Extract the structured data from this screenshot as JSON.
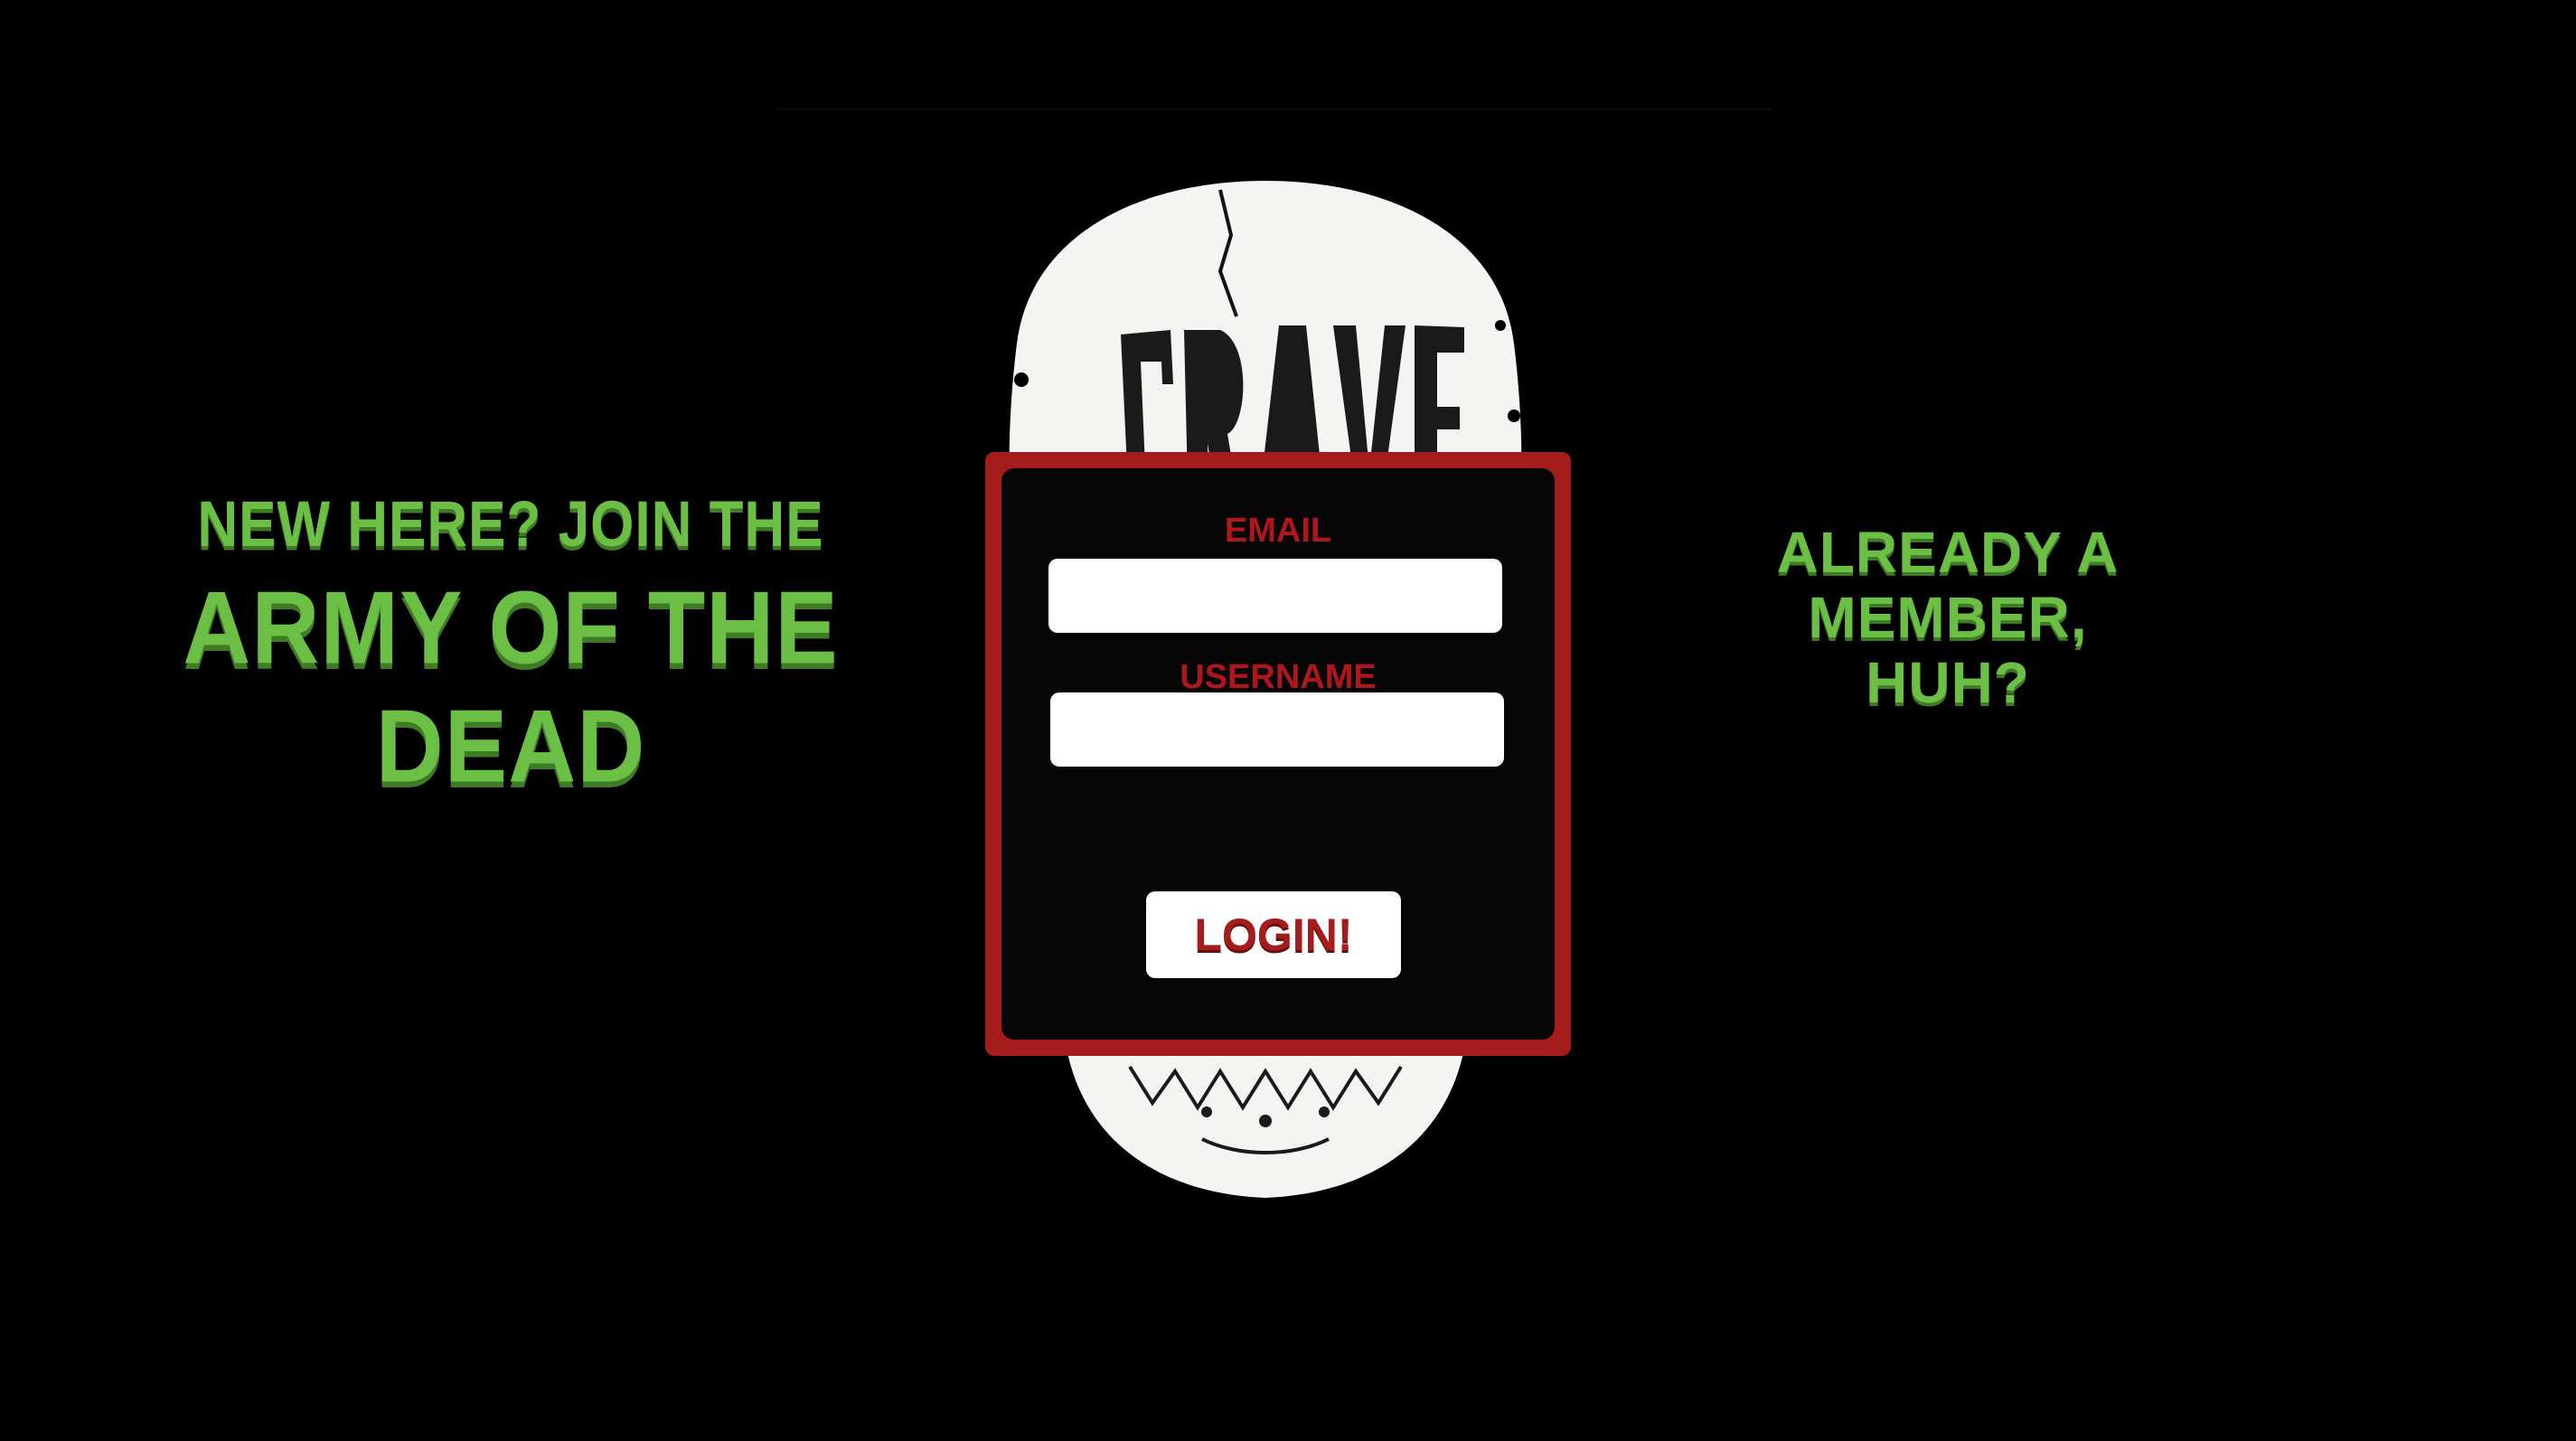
{
  "signup": {
    "line1": "NEW HERE? JOIN THE",
    "line2": "ARMY OF THE DEAD"
  },
  "member": {
    "line1": "ALREADY A MEMBER,",
    "line2": "HUH?"
  },
  "login_form": {
    "email_label": "EMAIL",
    "email_value": "",
    "username_label": "USERNAME",
    "username_value": "",
    "submit_label": "LOGIN!"
  },
  "logo": {
    "icon": "skull-logo-icon",
    "lettering": "GRAVE ROBBER"
  },
  "colors": {
    "background": "#000000",
    "accent_green": "#6cbf45",
    "accent_red": "#a51c1c",
    "panel_inner": "#060606",
    "input_bg": "#ffffff"
  }
}
